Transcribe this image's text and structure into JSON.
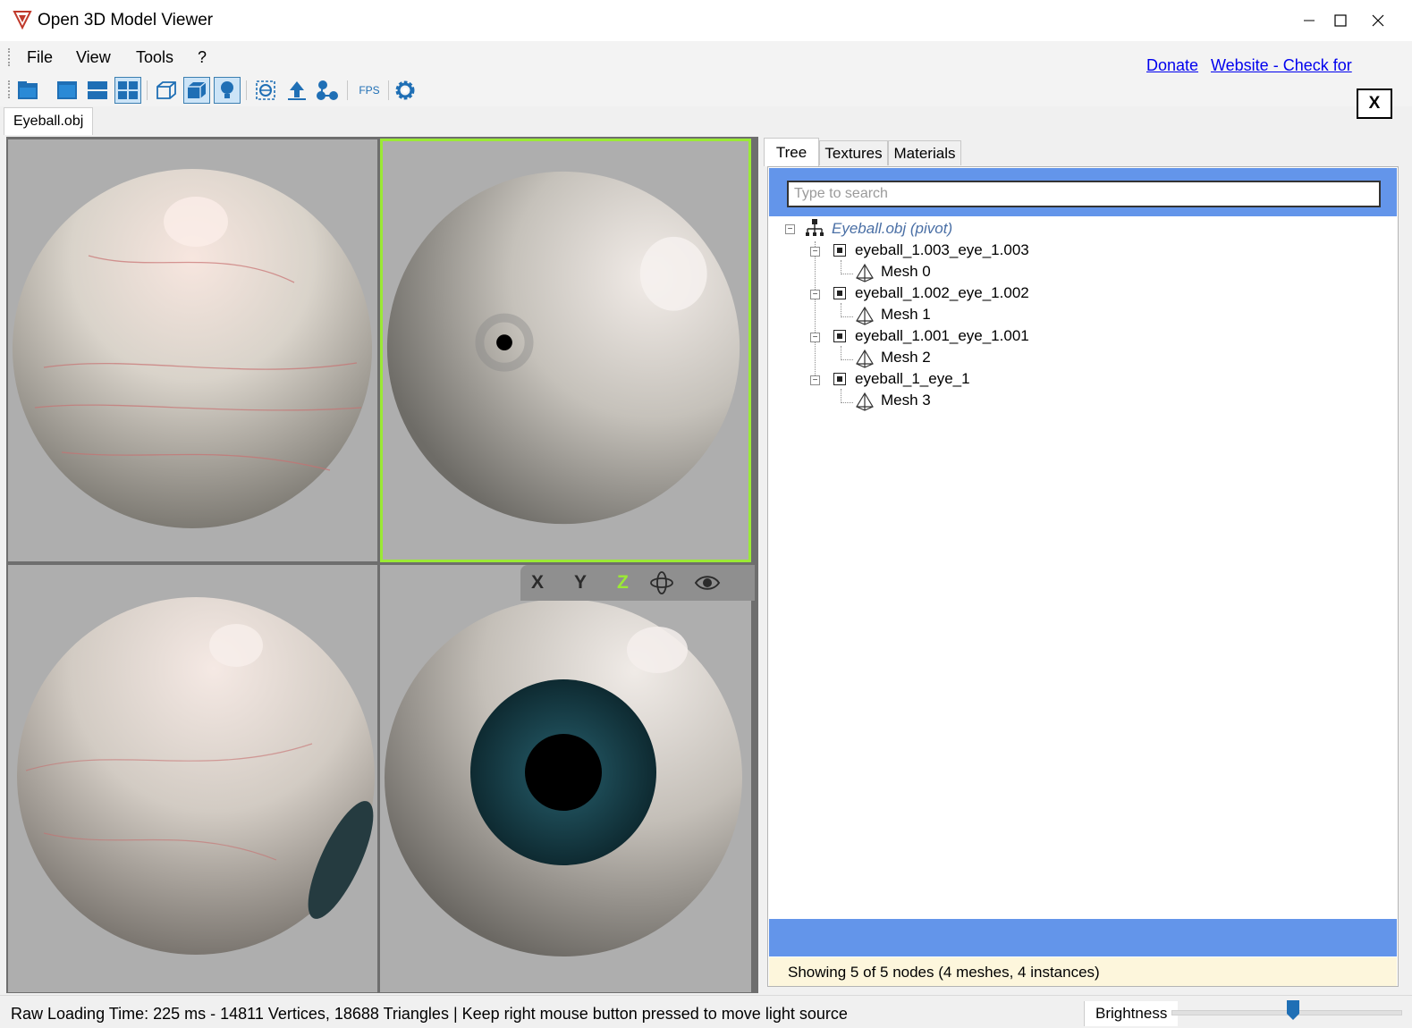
{
  "window": {
    "title": "Open 3D Model Viewer",
    "buttons": [
      "minimize-icon",
      "maximize-icon",
      "close-icon"
    ]
  },
  "menu": {
    "items": [
      "File",
      "View",
      "Tools",
      "?"
    ],
    "links": {
      "donate": "Donate",
      "website": "Website - Check for Updates"
    }
  },
  "toolbar": {
    "icons": [
      "open-folder-icon",
      "single-view-icon",
      "two-views-icon",
      "four-views-icon",
      "wireframe-icon",
      "textured-icon",
      "light-bulb-icon",
      "fit-view-icon",
      "upload-icon",
      "nodes-icon",
      "fps-icon",
      "settings-icon"
    ],
    "fps_label": "FPS",
    "close_label": "X"
  },
  "document_tab": "Eyeball.obj",
  "viewport": {
    "axis_buttons": [
      "X",
      "Y",
      "Z"
    ],
    "active_axis": "Z",
    "active_color": "#9bea35"
  },
  "panel": {
    "tabs": [
      "Tree",
      "Textures",
      "Materials"
    ],
    "selected_tab": "Tree",
    "search_placeholder": "Type to search",
    "tree": {
      "root": "Eyeball.obj (pivot)",
      "nodes": [
        {
          "name": "eyeball_1.003_eye_1.003",
          "mesh": "Mesh 0"
        },
        {
          "name": "eyeball_1.002_eye_1.002",
          "mesh": "Mesh 1"
        },
        {
          "name": "eyeball_1.001_eye_1.001",
          "mesh": "Mesh 2"
        },
        {
          "name": "eyeball_1_eye_1",
          "mesh": "Mesh 3"
        }
      ]
    },
    "status": "Showing 5 of 5 nodes (4 meshes, 4 instances)",
    "accent": "#6395ea"
  },
  "statusbar": {
    "text": "Raw Loading Time: 225 ms - 14811 Vertices, 18688 Triangles  | Keep right mouse button pressed to move light source",
    "brightness_label": "Brightness",
    "brightness_value": 0.53
  }
}
